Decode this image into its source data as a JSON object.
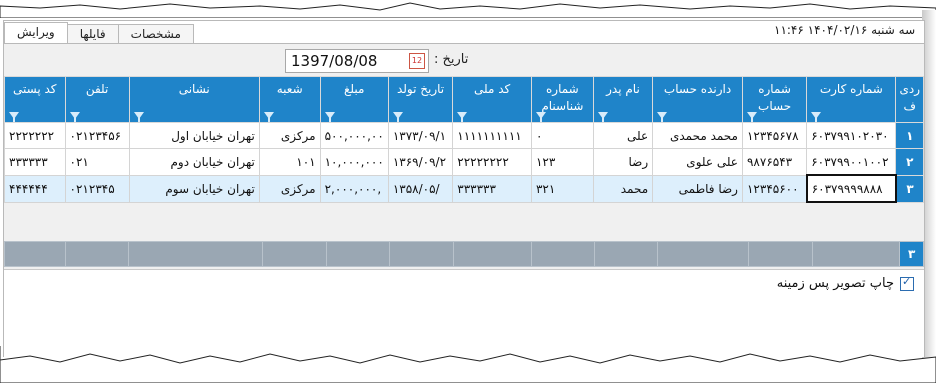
{
  "topbar": {
    "datetime": "سه شنبه ۱۴۰۴/۰۲/۱۶ ۱۱:۴۶",
    "tabs": [
      {
        "label": "ویرایش",
        "active": true
      },
      {
        "label": "فایلها",
        "active": false
      },
      {
        "label": "مشخصات",
        "active": false
      }
    ]
  },
  "date_filter": {
    "label": "تاریخ :",
    "value": "1397/08/08",
    "calendar_icon": "calendar-icon",
    "calendar_text": "12"
  },
  "grid": {
    "columns": [
      {
        "key": "rn",
        "label": "ردی ف"
      },
      {
        "key": "card",
        "label": "شماره کارت"
      },
      {
        "key": "acct",
        "label": "شماره حساب"
      },
      {
        "key": "holder",
        "label": "دارنده حساب"
      },
      {
        "key": "father",
        "label": "نام پدر"
      },
      {
        "key": "idno",
        "label": "شماره شناسنام"
      },
      {
        "key": "nid",
        "label": "کد ملی"
      },
      {
        "key": "birth",
        "label": "تاریخ تولد"
      },
      {
        "key": "amount",
        "label": "مبلغ"
      },
      {
        "key": "branch",
        "label": "شعبه"
      },
      {
        "key": "address",
        "label": "نشانی"
      },
      {
        "key": "phone",
        "label": "تلفن"
      },
      {
        "key": "postal",
        "label": "کد پستی"
      }
    ],
    "rows": [
      {
        "rn": "۱",
        "card": "۶۰۳۷۹۹۱۰۲۰۳۰",
        "acct": "۱۲۳۴۵۶۷۸",
        "holder": "محمد محمدی",
        "father": "علی",
        "idno": "۰",
        "nid": "۱۱۱۱۱۱۱۱۱۱",
        "birth": "۱۳۷۳/۰۹/۱",
        "amount": "۵۰۰,۰۰۰,۰۰",
        "branch": "مرکزی",
        "address": "تهران خیابان اول",
        "phone": "۰۲۱۲۳۴۵۶",
        "postal": "۲۲۲۲۲۲۲"
      },
      {
        "rn": "۲",
        "card": "۶۰۳۷۹۹۰۰۱۰۰۲",
        "acct": "۹۸۷۶۵۴۳",
        "holder": "علی علوی",
        "father": "رضا",
        "idno": "۱۲۳",
        "nid": "۲۲۲۲۲۲۲۲",
        "birth": "۱۳۶۹/۰۹/۲",
        "amount": "۱۰,۰۰۰,۰۰۰",
        "branch": "۱۰۱",
        "address": "تهران خیابان دوم",
        "phone": "۰۲۱",
        "postal": "۳۳۳۳۳۳"
      },
      {
        "rn": "۳",
        "card": "۶۰۳۷۹۹۹۹۸۸۸",
        "acct": "۱۲۳۴۵۶۰۰",
        "holder": "رضا فاطمی",
        "father": "محمد",
        "idno": "۳۲۱",
        "nid": "۳۳۳۳۳۳",
        "birth": "/۱۳۵۸/۰۵",
        "amount": ",۲,۰۰۰,۰۰۰",
        "branch": "مرکزی",
        "address": "تهران خیابان سوم",
        "phone": "۰۲۱۲۳۴۵",
        "postal": "۴۴۴۴۴۴"
      }
    ],
    "footer_count": "۳"
  },
  "options": {
    "print_background_label": "چاپ تصویر پس زمینه",
    "print_background_checked": true
  },
  "colors": {
    "header_blue": "#1f84c9",
    "selected_row": "#ddeffc",
    "footer_gray": "#9aa7b3"
  }
}
